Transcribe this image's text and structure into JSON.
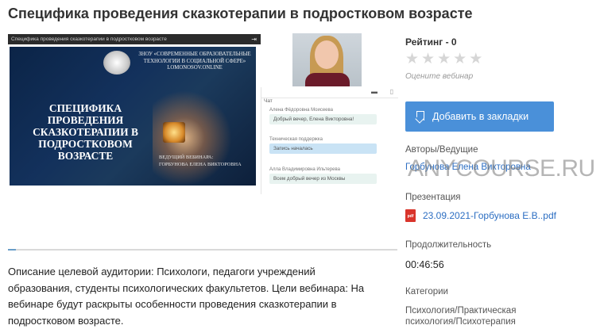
{
  "page": {
    "title": "Специфика проведения сказкотерапии в подростковом возрасте"
  },
  "player": {
    "bar_title": "Специфика проведения сказкотерапии в подростковом возрасте",
    "slide": {
      "logo_text": "ЗНОУ «СОВРЕМЕННЫЕ ОБРАЗОВАТЕЛЬНЫЕ ТЕХНОЛОГИИ В СОЦИАЛЬНОЙ СФЕРЕ» LOMONOSOV.ONLINE",
      "title": "СПЕЦИФИКА ПРОВЕДЕНИЯ СКАЗКОТЕРАПИИ В ПОДРОСТКОВОМ ВОЗРАСТЕ",
      "presenter_label": "ВЕДУЩИЙ ВЕБИНАРА:",
      "presenter_name": "ГОРБУНОВА ЕЛЕНА ВИКТОРОВНА"
    },
    "chat": {
      "label": "Чат",
      "messages": [
        {
          "author": "Алена Фёдоровна Моисеева",
          "text": "Добрый вечер, Елена Викторовна!"
        },
        {
          "author": "Техническая поддержка",
          "text": "Запись началась"
        },
        {
          "author": "Алла Владимировна Ильтерева",
          "text": "Всем добрый вечер из Москвы"
        }
      ]
    },
    "progress": 0.005
  },
  "description": "Описание целевой аудитории: Психологи, педагоги учреждений образования, студенты психологических факультетов. Цели вебинара: На вебинаре будут раскрыты особенности проведения сказкотерапии в подростковом возрасте.",
  "sidebar": {
    "rating_label": "Рейтинг - 0",
    "stars": [
      "★",
      "★",
      "★",
      "★",
      "★"
    ],
    "rating_value": 0,
    "rate_prompt": "Оцените вебинар",
    "bookmark_label": "Добавить в закладки",
    "authors_label": "Авторы/Ведущие",
    "authors_value": "Горбунова Елена Викторовна",
    "presentation_label": "Презентация",
    "pdf_icon_text": "pdf",
    "presentation_file": "23.09.2021-Горбунова Е.В..pdf",
    "duration_label": "Продолжительность",
    "duration_value": "00:46:56",
    "categories_label": "Категории",
    "categories_value": "Психология/Практическая психология/Психотерапия"
  },
  "watermark": "ANYCOURSE.RU",
  "colors": {
    "accent": "#4a90d9",
    "link": "#2c6ec2",
    "pdf": "#d9342b"
  }
}
